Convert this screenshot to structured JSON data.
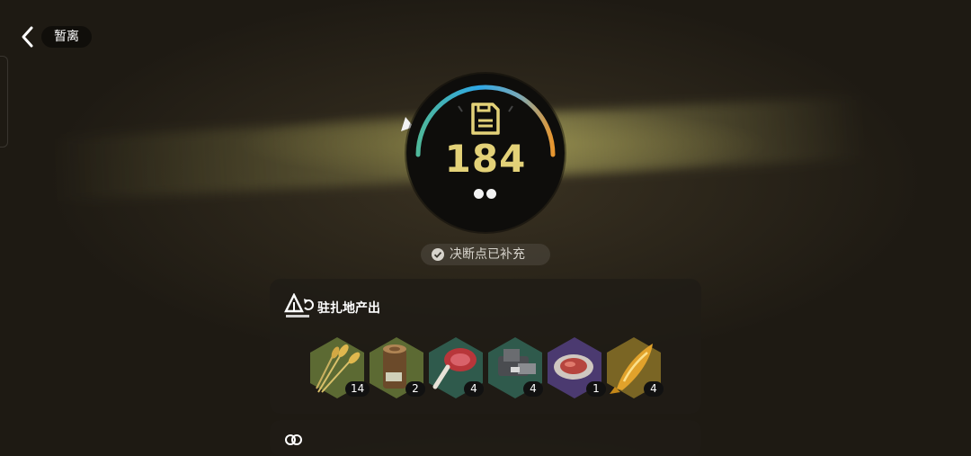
{
  "header": {
    "back_label": "暂离"
  },
  "dial": {
    "value": "184",
    "level": 0.85,
    "dots": 2,
    "arc_colors": [
      "#4fb89a",
      "#2ea7e6",
      "#e8962e"
    ]
  },
  "status": {
    "text": "决断点已补充"
  },
  "camp": {
    "title": "驻扎地产出",
    "items": [
      {
        "name": "wheat",
        "count": "14",
        "tier_color": "#5c6a33"
      },
      {
        "name": "tree-stump",
        "count": "2",
        "tier_color": "#5c6a33"
      },
      {
        "name": "meat-steak",
        "count": "4",
        "tier_color": "#2f5a4c"
      },
      {
        "name": "metal-parts",
        "count": "4",
        "tier_color": "#2f5a4c"
      },
      {
        "name": "meat-plate",
        "count": "1",
        "tier_color": "#4b3a70"
      },
      {
        "name": "golden-fish",
        "count": "4",
        "tier_color": "#7a6524"
      }
    ]
  }
}
